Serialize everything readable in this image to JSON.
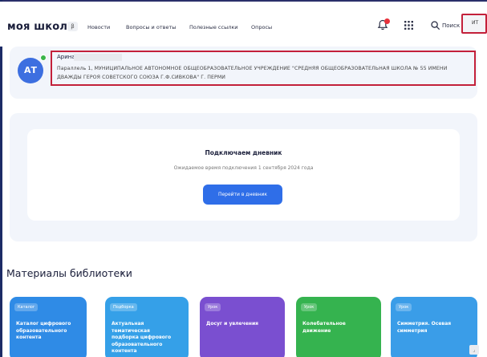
{
  "header": {
    "logo": "моя школа",
    "beta": "β",
    "nav": [
      "Новости",
      "Вопросы и ответы",
      "Полезные ссылки",
      "Опросы"
    ],
    "search_label": "Поиск",
    "user_initials": "ИТ"
  },
  "profile": {
    "avatar_initials": "АТ",
    "name": "Арина",
    "description": "Параллель 1, МУНИЦИПАЛЬНОЕ АВТОНОМНОЕ ОБЩЕОБРАЗОВАТЕЛЬНОЕ УЧРЕЖДЕНИЕ \"СРЕДНЯЯ ОБЩЕОБРАЗОВАТЕЛЬНАЯ ШКОЛА № 55 ИМЕНИ ДВАЖДЫ ГЕРОЯ СОВЕТСКОГО СОЮЗА Г.Ф.СИВКОВА\" Г. ПЕРМИ"
  },
  "diary": {
    "title": "Подключаем дневник",
    "subtitle": "Ожидаемое время подключения 1 сентября 2024 года",
    "button": "Перейти в дневник"
  },
  "library": {
    "title": "Материалы библиотеки",
    "chevron": "›",
    "cards": [
      {
        "tag": "Каталог",
        "title": "Каталог цифрового образовательного контента",
        "color": "#2f8be6"
      },
      {
        "tag": "Подборка",
        "title": "Актуальная тематическая подборка цифрового образовательного контента",
        "color": "#35a0e8"
      },
      {
        "tag": "Урок",
        "title": "Досуг и увлечения",
        "color": "#7a4fd0"
      },
      {
        "tag": "Урок",
        "title": "Колебательное движение",
        "color": "#35b34f"
      },
      {
        "tag": "Урок",
        "title": "Симметрия. Осевая симметрия",
        "color": "#3a9de8"
      }
    ]
  },
  "colors": {
    "accent": "#2f6ee8",
    "highlight_frame": "#c3203a",
    "avatar": "#3d6fe0",
    "online": "#3ab54a",
    "notification": "#e8323c"
  },
  "icons": [
    "bell-icon",
    "apps-grid-icon",
    "search-icon",
    "chevron-right-icon"
  ]
}
